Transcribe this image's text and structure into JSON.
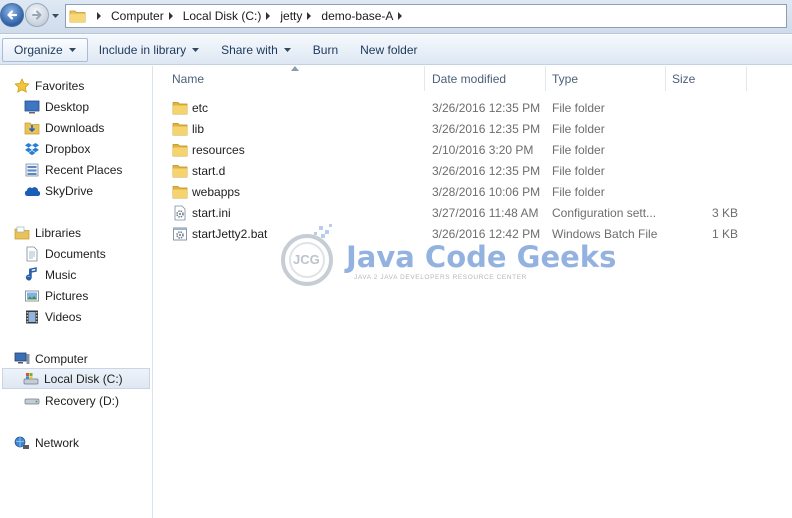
{
  "breadcrumbs": [
    "Computer",
    "Local Disk (C:)",
    "jetty",
    "demo-base-A"
  ],
  "toolbar": {
    "organize": "Organize",
    "include_in_library": "Include in library",
    "share_with": "Share with",
    "burn": "Burn",
    "new_folder": "New folder"
  },
  "nav": {
    "favorites": "Favorites",
    "desktop": "Desktop",
    "downloads": "Downloads",
    "dropbox": "Dropbox",
    "recent_places": "Recent Places",
    "skydrive": "SkyDrive",
    "libraries": "Libraries",
    "documents": "Documents",
    "music": "Music",
    "pictures": "Pictures",
    "videos": "Videos",
    "computer": "Computer",
    "local_disk": "Local Disk (C:)",
    "recovery": "Recovery (D:)",
    "network": "Network"
  },
  "columns": {
    "name": "Name",
    "date_modified": "Date modified",
    "type": "Type",
    "size": "Size"
  },
  "files": [
    {
      "name": "etc",
      "date": "3/26/2016 12:35 PM",
      "type": "File folder",
      "size": "",
      "icon": "folder-icon"
    },
    {
      "name": "lib",
      "date": "3/26/2016 12:35 PM",
      "type": "File folder",
      "size": "",
      "icon": "folder-icon"
    },
    {
      "name": "resources",
      "date": "2/10/2016 3:20 PM",
      "type": "File folder",
      "size": "",
      "icon": "folder-icon"
    },
    {
      "name": "start.d",
      "date": "3/26/2016 12:35 PM",
      "type": "File folder",
      "size": "",
      "icon": "folder-icon"
    },
    {
      "name": "webapps",
      "date": "3/28/2016 10:06 PM",
      "type": "File folder",
      "size": "",
      "icon": "folder-icon"
    },
    {
      "name": "start.ini",
      "date": "3/27/2016 11:48 AM",
      "type": "Configuration sett...",
      "size": "3 KB",
      "icon": "config-file-icon"
    },
    {
      "name": "startJetty2.bat",
      "date": "3/26/2016 12:42 PM",
      "type": "Windows Batch File",
      "size": "1 KB",
      "icon": "batch-file-icon"
    }
  ],
  "watermark": {
    "badge": "JCG",
    "title": "Java Code Geeks",
    "subtitle": "JAVA 2 JAVA DEVELOPERS RESOURCE CENTER"
  }
}
